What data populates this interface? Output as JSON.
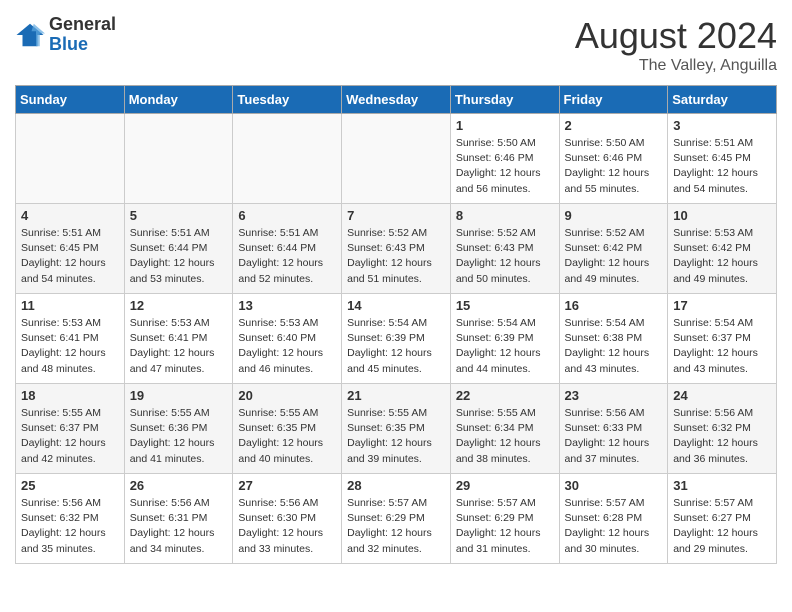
{
  "logo": {
    "general": "General",
    "blue": "Blue"
  },
  "title": {
    "month_year": "August 2024",
    "location": "The Valley, Anguilla"
  },
  "days_of_week": [
    "Sunday",
    "Monday",
    "Tuesday",
    "Wednesday",
    "Thursday",
    "Friday",
    "Saturday"
  ],
  "weeks": [
    [
      {
        "day": "",
        "info": ""
      },
      {
        "day": "",
        "info": ""
      },
      {
        "day": "",
        "info": ""
      },
      {
        "day": "",
        "info": ""
      },
      {
        "day": "1",
        "info": "Sunrise: 5:50 AM\nSunset: 6:46 PM\nDaylight: 12 hours\nand 56 minutes."
      },
      {
        "day": "2",
        "info": "Sunrise: 5:50 AM\nSunset: 6:46 PM\nDaylight: 12 hours\nand 55 minutes."
      },
      {
        "day": "3",
        "info": "Sunrise: 5:51 AM\nSunset: 6:45 PM\nDaylight: 12 hours\nand 54 minutes."
      }
    ],
    [
      {
        "day": "4",
        "info": "Sunrise: 5:51 AM\nSunset: 6:45 PM\nDaylight: 12 hours\nand 54 minutes."
      },
      {
        "day": "5",
        "info": "Sunrise: 5:51 AM\nSunset: 6:44 PM\nDaylight: 12 hours\nand 53 minutes."
      },
      {
        "day": "6",
        "info": "Sunrise: 5:51 AM\nSunset: 6:44 PM\nDaylight: 12 hours\nand 52 minutes."
      },
      {
        "day": "7",
        "info": "Sunrise: 5:52 AM\nSunset: 6:43 PM\nDaylight: 12 hours\nand 51 minutes."
      },
      {
        "day": "8",
        "info": "Sunrise: 5:52 AM\nSunset: 6:43 PM\nDaylight: 12 hours\nand 50 minutes."
      },
      {
        "day": "9",
        "info": "Sunrise: 5:52 AM\nSunset: 6:42 PM\nDaylight: 12 hours\nand 49 minutes."
      },
      {
        "day": "10",
        "info": "Sunrise: 5:53 AM\nSunset: 6:42 PM\nDaylight: 12 hours\nand 49 minutes."
      }
    ],
    [
      {
        "day": "11",
        "info": "Sunrise: 5:53 AM\nSunset: 6:41 PM\nDaylight: 12 hours\nand 48 minutes."
      },
      {
        "day": "12",
        "info": "Sunrise: 5:53 AM\nSunset: 6:41 PM\nDaylight: 12 hours\nand 47 minutes."
      },
      {
        "day": "13",
        "info": "Sunrise: 5:53 AM\nSunset: 6:40 PM\nDaylight: 12 hours\nand 46 minutes."
      },
      {
        "day": "14",
        "info": "Sunrise: 5:54 AM\nSunset: 6:39 PM\nDaylight: 12 hours\nand 45 minutes."
      },
      {
        "day": "15",
        "info": "Sunrise: 5:54 AM\nSunset: 6:39 PM\nDaylight: 12 hours\nand 44 minutes."
      },
      {
        "day": "16",
        "info": "Sunrise: 5:54 AM\nSunset: 6:38 PM\nDaylight: 12 hours\nand 43 minutes."
      },
      {
        "day": "17",
        "info": "Sunrise: 5:54 AM\nSunset: 6:37 PM\nDaylight: 12 hours\nand 43 minutes."
      }
    ],
    [
      {
        "day": "18",
        "info": "Sunrise: 5:55 AM\nSunset: 6:37 PM\nDaylight: 12 hours\nand 42 minutes."
      },
      {
        "day": "19",
        "info": "Sunrise: 5:55 AM\nSunset: 6:36 PM\nDaylight: 12 hours\nand 41 minutes."
      },
      {
        "day": "20",
        "info": "Sunrise: 5:55 AM\nSunset: 6:35 PM\nDaylight: 12 hours\nand 40 minutes."
      },
      {
        "day": "21",
        "info": "Sunrise: 5:55 AM\nSunset: 6:35 PM\nDaylight: 12 hours\nand 39 minutes."
      },
      {
        "day": "22",
        "info": "Sunrise: 5:55 AM\nSunset: 6:34 PM\nDaylight: 12 hours\nand 38 minutes."
      },
      {
        "day": "23",
        "info": "Sunrise: 5:56 AM\nSunset: 6:33 PM\nDaylight: 12 hours\nand 37 minutes."
      },
      {
        "day": "24",
        "info": "Sunrise: 5:56 AM\nSunset: 6:32 PM\nDaylight: 12 hours\nand 36 minutes."
      }
    ],
    [
      {
        "day": "25",
        "info": "Sunrise: 5:56 AM\nSunset: 6:32 PM\nDaylight: 12 hours\nand 35 minutes."
      },
      {
        "day": "26",
        "info": "Sunrise: 5:56 AM\nSunset: 6:31 PM\nDaylight: 12 hours\nand 34 minutes."
      },
      {
        "day": "27",
        "info": "Sunrise: 5:56 AM\nSunset: 6:30 PM\nDaylight: 12 hours\nand 33 minutes."
      },
      {
        "day": "28",
        "info": "Sunrise: 5:57 AM\nSunset: 6:29 PM\nDaylight: 12 hours\nand 32 minutes."
      },
      {
        "day": "29",
        "info": "Sunrise: 5:57 AM\nSunset: 6:29 PM\nDaylight: 12 hours\nand 31 minutes."
      },
      {
        "day": "30",
        "info": "Sunrise: 5:57 AM\nSunset: 6:28 PM\nDaylight: 12 hours\nand 30 minutes."
      },
      {
        "day": "31",
        "info": "Sunrise: 5:57 AM\nSunset: 6:27 PM\nDaylight: 12 hours\nand 29 minutes."
      }
    ]
  ]
}
